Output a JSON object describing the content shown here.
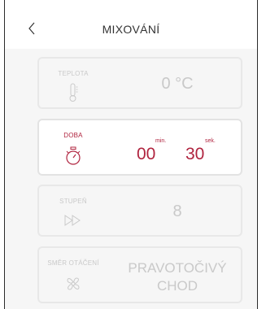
{
  "header": {
    "back_icon": "chevron-left-icon",
    "title": "MIXOVÁNÍ"
  },
  "colors": {
    "accent": "#b0243f",
    "muted": "#c9c9c9",
    "card_border": "#e8e8e8",
    "panel_bg": "#f6f6f6"
  },
  "settings": {
    "temperature": {
      "label": "TEPLOTA",
      "icon": "thermometer-icon",
      "value": "0 °C"
    },
    "time": {
      "label": "DOBA",
      "icon": "stopwatch-icon",
      "minutes": "00",
      "minutes_unit": "min.",
      "seconds": "30",
      "seconds_unit": "sek."
    },
    "speed": {
      "label": "STUPEŇ",
      "icon": "fast-forward-icon",
      "value": "8"
    },
    "direction": {
      "label": "SMĚR OTÁČENÍ",
      "icon": "fan-icon",
      "value_line1": "PRAVOTOČIVÝ",
      "value_line2": "CHOD"
    }
  }
}
